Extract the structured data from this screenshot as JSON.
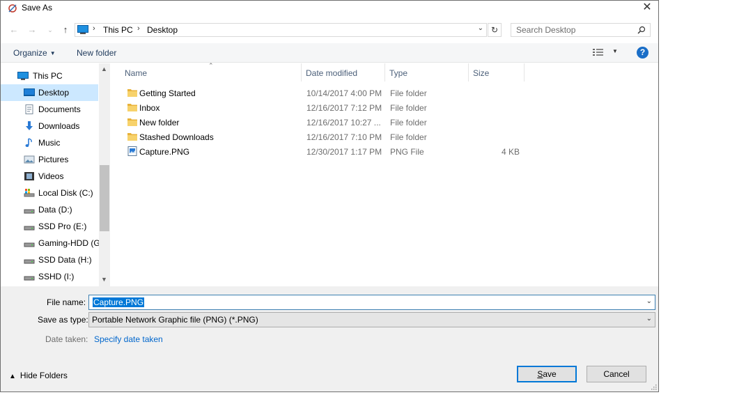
{
  "window": {
    "title": "Save As"
  },
  "address": {
    "crumbs": [
      "This PC",
      "Desktop"
    ]
  },
  "search": {
    "placeholder": "Search Desktop"
  },
  "commands": {
    "organize": "Organize",
    "new_folder": "New folder"
  },
  "nav": [
    {
      "label": "This PC",
      "icon": "computer-icon",
      "level": 0
    },
    {
      "label": "Desktop",
      "icon": "desktop-icon",
      "level": 1,
      "selected": true
    },
    {
      "label": "Documents",
      "icon": "documents-icon",
      "level": 1
    },
    {
      "label": "Downloads",
      "icon": "downloads-icon",
      "level": 1
    },
    {
      "label": "Music",
      "icon": "music-icon",
      "level": 1
    },
    {
      "label": "Pictures",
      "icon": "pictures-icon",
      "level": 1
    },
    {
      "label": "Videos",
      "icon": "videos-icon",
      "level": 1
    },
    {
      "label": "Local Disk (C:)",
      "icon": "system-drive-icon",
      "level": 1
    },
    {
      "label": "Data (D:)",
      "icon": "drive-icon",
      "level": 1
    },
    {
      "label": "SSD Pro (E:)",
      "icon": "drive-icon",
      "level": 1
    },
    {
      "label": "Gaming-HDD (G",
      "icon": "drive-icon",
      "level": 1
    },
    {
      "label": "SSD Data (H:)",
      "icon": "drive-icon",
      "level": 1
    },
    {
      "label": "SSHD (I:)",
      "icon": "drive-icon",
      "level": 1
    }
  ],
  "columns": [
    "Name",
    "Date modified",
    "Type",
    "Size"
  ],
  "files": [
    {
      "name": "Getting Started",
      "date": "10/14/2017 4:00 PM",
      "type": "File folder",
      "size": "",
      "icon": "folder-icon"
    },
    {
      "name": "Inbox",
      "date": "12/16/2017 7:12 PM",
      "type": "File folder",
      "size": "",
      "icon": "folder-icon"
    },
    {
      "name": "New folder",
      "date": "12/16/2017 10:27 ...",
      "type": "File folder",
      "size": "",
      "icon": "folder-icon"
    },
    {
      "name": "Stashed Downloads",
      "date": "12/16/2017 7:10 PM",
      "type": "File folder",
      "size": "",
      "icon": "folder-icon"
    },
    {
      "name": "Capture.PNG",
      "date": "12/30/2017 1:17 PM",
      "type": "PNG File",
      "size": "4 KB",
      "icon": "png-file-icon"
    }
  ],
  "form": {
    "filename_label": "File name:",
    "filename_value": "Capture.PNG",
    "savetype_label": "Save as type:",
    "savetype_value": "Portable Network Graphic file (PNG) (*.PNG)",
    "date_label": "Date taken:",
    "date_link": "Specify date taken"
  },
  "footer": {
    "hide_folders": "Hide Folders",
    "save_first": "S",
    "save_rest": "ave",
    "cancel": "Cancel"
  },
  "colors": {
    "accent": "#0078d7",
    "selection": "#cce8ff",
    "link": "#0066cc",
    "help": "#1a6ec7"
  }
}
